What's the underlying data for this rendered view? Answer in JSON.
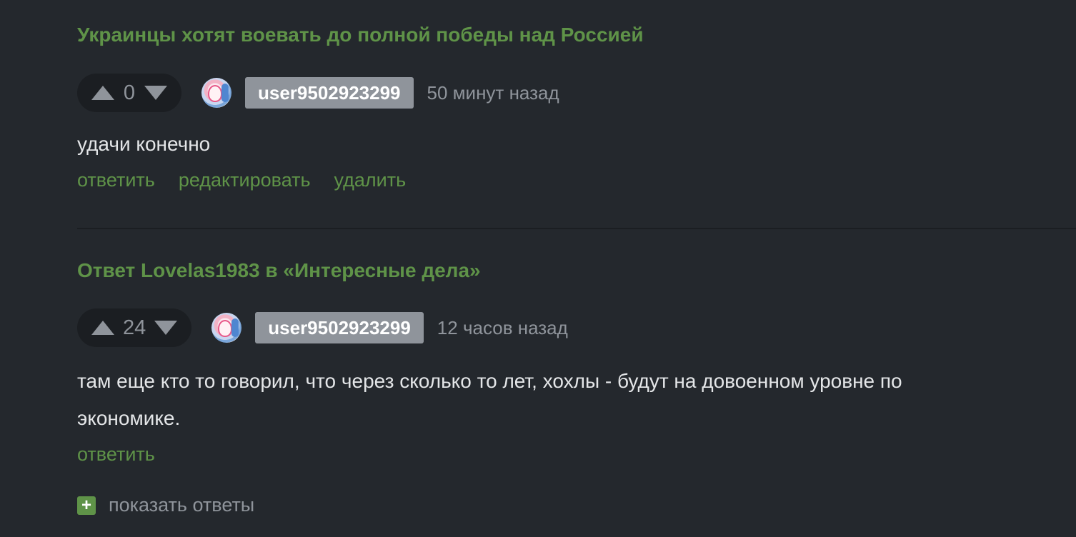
{
  "comments": [
    {
      "story_title": "Украинцы хотят воевать до полной победы над Россией",
      "rating": "0",
      "username": "user9502923299",
      "time": "50 минут назад",
      "text": "удачи конечно",
      "actions": [
        "ответить",
        "редактировать",
        "удалить"
      ]
    },
    {
      "story_title": "Ответ Lovelas1983 в «Интересные дела»",
      "rating": "24",
      "username": "user9502923299",
      "time": "12 часов назад",
      "text": "там еще кто то говорил, что через сколько то лет, хохлы - будут на довоенном уровне по экономике.",
      "actions": [
        "ответить"
      ],
      "show_replies_icon": "+",
      "show_replies_label": "показать ответы"
    }
  ],
  "colors": {
    "background": "#24282d",
    "accent_green": "#5f9348",
    "muted_gray": "#8f949b",
    "text": "#e4e6e8",
    "rating_bg": "#1b1e22"
  },
  "icons": {
    "upvote": "arrow-up-icon",
    "downvote": "arrow-down-icon",
    "expand": "plus-icon"
  }
}
